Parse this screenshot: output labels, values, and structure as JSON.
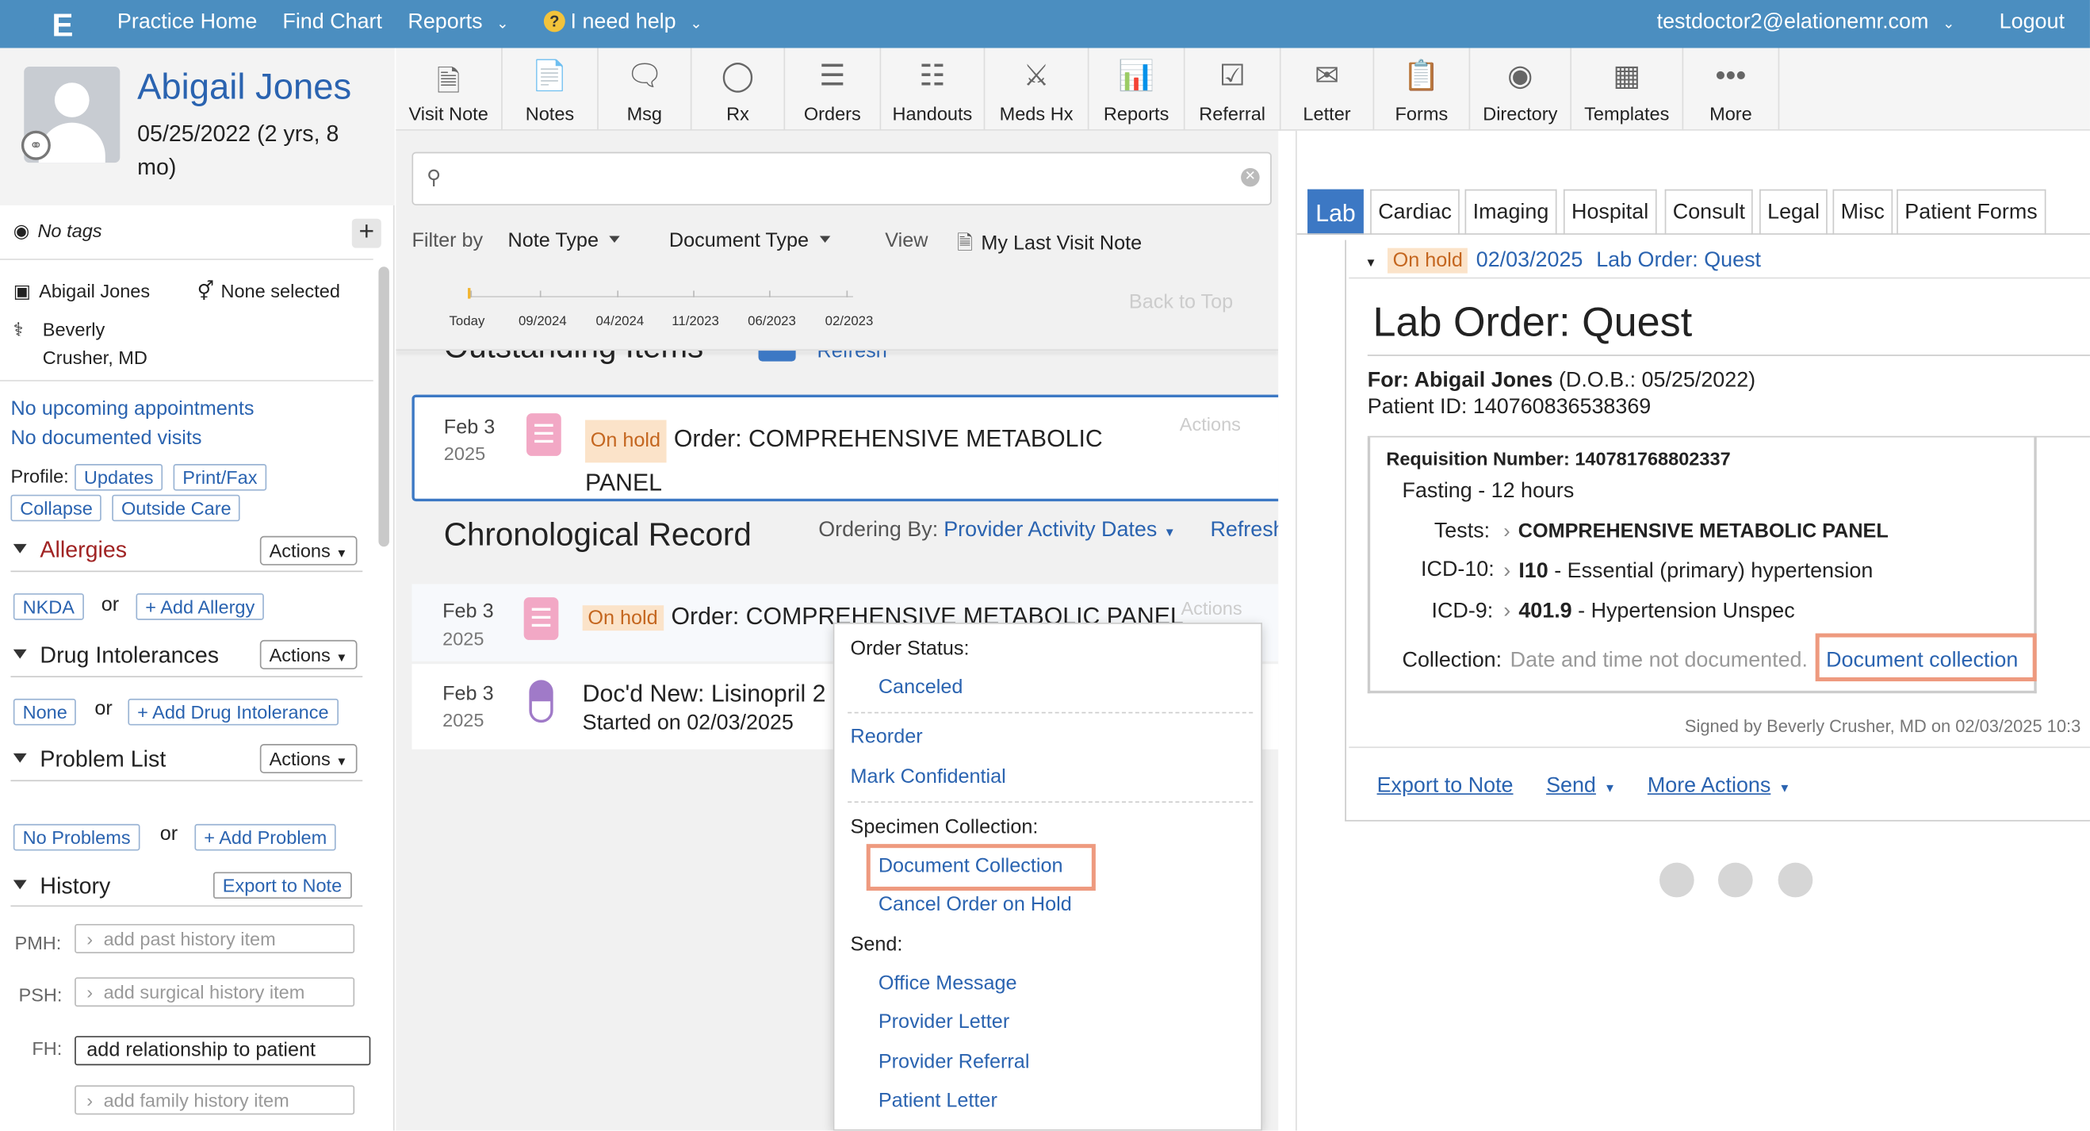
{
  "topbar": {
    "logo": "E",
    "practice_home": "Practice Home",
    "find_chart": "Find Chart",
    "reports": "Reports",
    "help": "I need help",
    "user": "testdoctor2@elationemr.com",
    "logout": "Logout",
    "bg_color": "#4b8ec0"
  },
  "patient": {
    "name": "Abigail Jones",
    "dob": "05/25/2022 (2 yrs, 8 mo)",
    "tags": "No tags",
    "short_name": "Abigail Jones",
    "gender": "None selected",
    "provider_line1": "Beverly",
    "provider_line2": "Crusher, MD",
    "no_appointments": "No upcoming appointments",
    "no_visits": "No documented visits",
    "profile_label": "Profile:",
    "profile_updates": "Updates",
    "profile_printfax": "Print/Fax",
    "profile_collapse": "Collapse",
    "profile_outside": "Outside Care"
  },
  "sections": {
    "allergies": "Allergies",
    "allergies_nkda": "NKDA",
    "or": "or",
    "add_allergy": "+ Add Allergy",
    "drug_intolerances": "Drug Intolerances",
    "drug_none": "None",
    "add_drug": "+ Add Drug Intolerance",
    "problem_list": "Problem List",
    "no_problems": "No Problems",
    "add_problem": "+ Add Problem",
    "history": "History",
    "export_to_note": "Export to Note",
    "actions": "Actions",
    "pmh": "PMH:",
    "pmh_placeholder": "add past history item",
    "psh": "PSH:",
    "psh_placeholder": "add surgical history item",
    "fh": "FH:",
    "fh_value": "add relationship to patient",
    "fh_placeholder": "add family history item"
  },
  "toolbar": [
    {
      "label": "Visit Note",
      "icon": "document-icon"
    },
    {
      "label": "Notes",
      "icon": "file-icon"
    },
    {
      "label": "Msg",
      "icon": "message-icon"
    },
    {
      "label": "Rx",
      "icon": "pill-icon"
    },
    {
      "label": "Orders",
      "icon": "list-icon"
    },
    {
      "label": "Handouts",
      "icon": "stack-icon"
    },
    {
      "label": "Meds Hx",
      "icon": "meds-icon"
    },
    {
      "label": "Reports",
      "icon": "clipboard-chart-icon"
    },
    {
      "label": "Referral",
      "icon": "referral-icon"
    },
    {
      "label": "Letter",
      "icon": "envelope-icon"
    },
    {
      "label": "Forms",
      "icon": "forms-icon"
    },
    {
      "label": "Directory",
      "icon": "directory-icon"
    },
    {
      "label": "Templates",
      "icon": "templates-icon"
    },
    {
      "label": "More",
      "icon": "more-icon"
    }
  ],
  "center": {
    "filter_by": "Filter by",
    "note_type": "Note Type",
    "document_type": "Document Type",
    "view": "View",
    "my_last_visit": "My Last Visit Note",
    "back_to_top": "Back to Top",
    "timeline": [
      "Today",
      "09/2024",
      "04/2024",
      "11/2023",
      "06/2023",
      "02/2023"
    ],
    "outstanding": "Outstanding Items",
    "refresh": "Refresh",
    "outstanding_date": "Feb 3",
    "outstanding_year": "2025",
    "on_hold": "On hold",
    "outstanding_title": "Order: COMPREHENSIVE METABOLIC PANEL",
    "actions": "Actions",
    "chronological": "Chronological Record",
    "ordering_by": "Ordering By:",
    "provider_activity": "Provider Activity Dates",
    "refresh2": "Refresh",
    "row1_date": "Feb 3",
    "row1_year": "2025",
    "row1_title": "Order: COMPREHENSIVE METABOLIC PANEL",
    "row2_date": "Feb 3",
    "row2_year": "2025",
    "row2_title": "Doc'd New: Lisinopril 2",
    "row2_sub": "Started on 02/03/2025"
  },
  "menu": {
    "order_status": "Order Status:",
    "canceled": "Canceled",
    "reorder": "Reorder",
    "mark_confidential": "Mark Confidential",
    "specimen_collection": "Specimen Collection:",
    "document_collection": "Document Collection",
    "cancel_order_on_hold": "Cancel Order on Hold",
    "send": "Send:",
    "office_message": "Office Message",
    "provider_letter": "Provider Letter",
    "provider_referral": "Provider Referral",
    "patient_letter": "Patient Letter"
  },
  "right": {
    "tabs": [
      "Lab",
      "Cardiac",
      "Imaging",
      "Hospital",
      "Consult",
      "Legal",
      "Misc",
      "Patient Forms"
    ],
    "header_status": "On hold",
    "header_date": "02/03/2025",
    "header_title": "Lab Order: Quest",
    "title": "Lab Order: Quest",
    "for_label": "For: Abigail Jones",
    "for_dob": "(D.O.B.: 05/25/2022)",
    "patient_id": "Patient ID: 140760836538369",
    "requisition": "Requisition Number: 140781768802337",
    "fasting": "Fasting - 12 hours",
    "tests_label": "Tests:",
    "tests_value": "COMPREHENSIVE METABOLIC PANEL",
    "icd10_label": "ICD-10:",
    "icd10_code": "I10",
    "icd10_desc": "- Essential (primary) hypertension",
    "icd9_label": "ICD-9:",
    "icd9_code": "401.9",
    "icd9_desc": "- Hypertension Unspec",
    "collection_label": "Collection:",
    "collection_value": "Date and time not documented.",
    "document_collection": "Document collection",
    "signed": "Signed by Beverly Crusher, MD on 02/03/2025 10:3",
    "export_to_note": "Export to Note",
    "send": "Send",
    "more_actions": "More Actions"
  },
  "colors": {
    "accent": "#2a63b0",
    "on_hold_bg": "#fbe3c9",
    "on_hold_text": "#c4661f",
    "highlight": "#ee9a7f",
    "allergy_red": "#a02323"
  }
}
